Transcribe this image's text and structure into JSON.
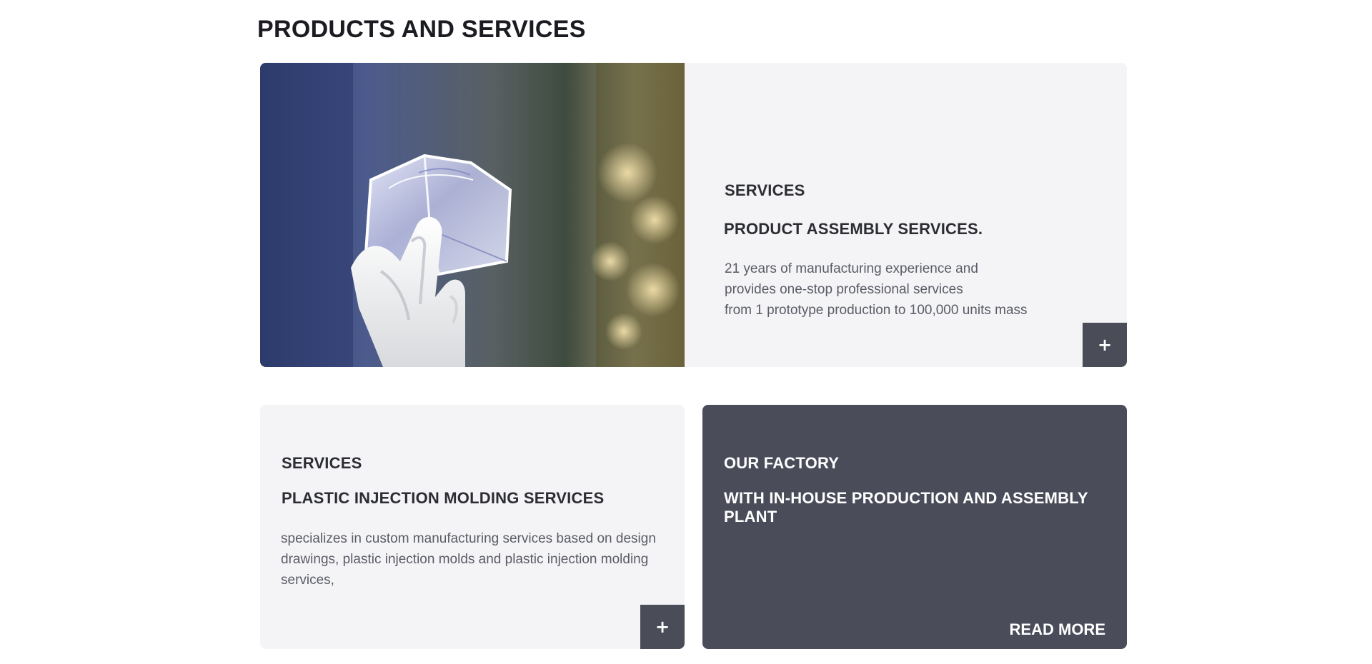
{
  "section": {
    "title": "PRODUCTS AND SERVICES"
  },
  "feature": {
    "image_subject": "gloved hand holding a clear plastic molded part",
    "eyebrow": "SERVICES",
    "title": "PRODUCT ASSEMBLY SERVICES.",
    "lines": [
      "21 years of manufacturing experience and",
      "provides one-stop professional services",
      "from 1 prototype production to 100,000 units mass"
    ],
    "button_label": "+"
  },
  "cards": {
    "services": {
      "eyebrow": "SERVICES",
      "title": "PLASTIC INJECTION MOLDING SERVICES",
      "lines": [
        "specializes in custom manufacturing services based on design",
        "drawings, plastic injection molds and plastic injection molding",
        "services,"
      ],
      "button_label": "+"
    },
    "factory": {
      "eyebrow": "OUR FACTORY",
      "title": "WITH IN-HOUSE PRODUCTION AND ASSEMBLY PLANT",
      "link_label": "READ MORE"
    }
  },
  "colors": {
    "card_light": "#f4f4f6",
    "card_dark": "#4a4c5a",
    "button_dark": "#4a4c58",
    "heading": "#1b1c21"
  }
}
